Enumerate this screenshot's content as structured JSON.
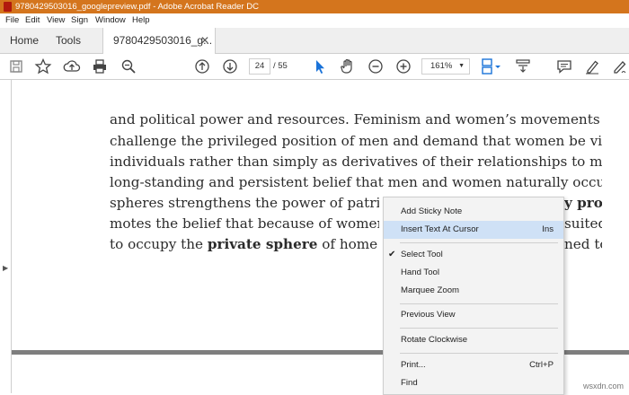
{
  "window": {
    "title": "9780429503016_googlepreview.pdf - Adobe Acrobat Reader DC"
  },
  "menu": [
    "File",
    "Edit",
    "View",
    "Sign",
    "Window",
    "Help"
  ],
  "tabs": {
    "home": "Home",
    "tools": "Tools",
    "document": "9780429503016_g...",
    "close_glyph": "✕"
  },
  "toolbar": {
    "page_current": "24",
    "page_total": "/ 55",
    "zoom": "161%"
  },
  "document": {
    "lines": [
      "and political power and resources. Feminism and women’s movements directly",
      "challenge the privileged position of men and demand that women be viewed as",
      "individuals rather than simply as derivatives of their relationships to men. The",
      "long-standing and persistent belief that men and women naturally occupy separate"
    ],
    "line5_left": "spheres strengthens the power of patriarchy. T",
    "line5_right": "y pro-",
    "line6_left": "motes the belief that because of women’s role",
    "line6_right": "suited",
    "line7_pre": "to occupy the ",
    "line7_bold": "private sphere",
    "line7_post": " of home and f",
    "line7_right": "ned to"
  },
  "context_menu": {
    "items": [
      {
        "label": "Add Sticky Note",
        "shortcut": ""
      },
      {
        "label": "Insert Text At Cursor",
        "shortcut": "Ins"
      },
      {
        "label": "Select Tool",
        "shortcut": "",
        "checked": "✔"
      },
      {
        "label": "Hand Tool",
        "shortcut": ""
      },
      {
        "label": "Marquee Zoom",
        "shortcut": ""
      },
      {
        "label": "Previous View",
        "shortcut": ""
      },
      {
        "label": "Rotate Clockwise",
        "shortcut": ""
      },
      {
        "label": "Print...",
        "shortcut": "Ctrl+P"
      },
      {
        "label": "Find",
        "shortcut": ""
      }
    ]
  },
  "watermark": "wsxdn.com",
  "colors": {
    "titlebar": "#d4751d",
    "accent_blue": "#1a73d9",
    "highlight": "#cfe1f6"
  }
}
